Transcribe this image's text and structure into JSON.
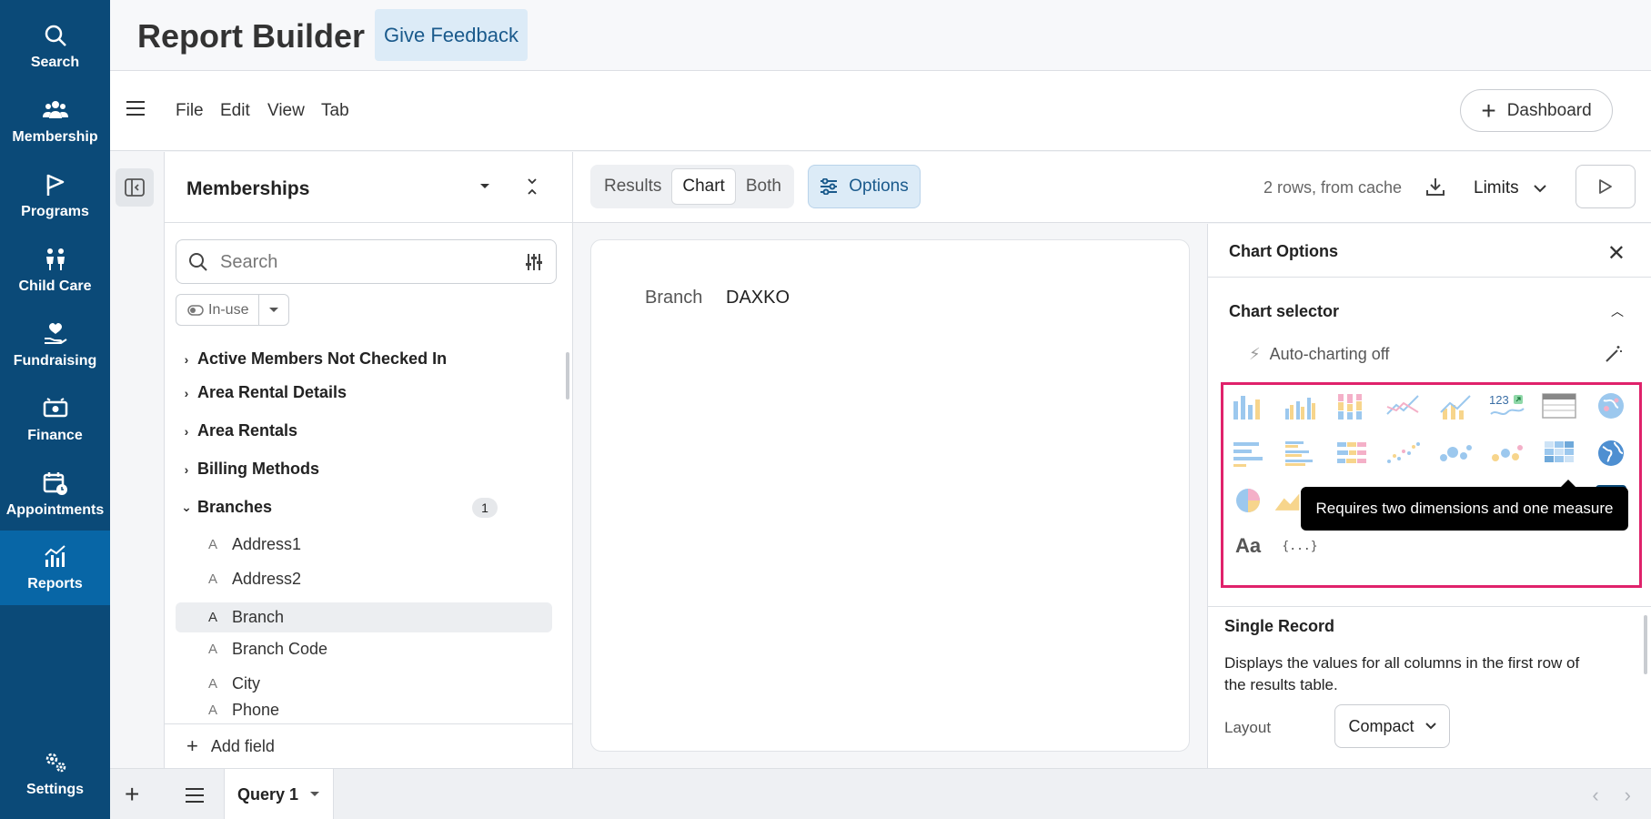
{
  "nav": {
    "items": [
      {
        "label": "Search",
        "icon": "search-icon"
      },
      {
        "label": "Membership",
        "icon": "people-icon"
      },
      {
        "label": "Programs",
        "icon": "flag-icon"
      },
      {
        "label": "Child Care",
        "icon": "child-care-icon"
      },
      {
        "label": "Fundraising",
        "icon": "heart-hand-icon"
      },
      {
        "label": "Finance",
        "icon": "money-icon"
      },
      {
        "label": "Appointments",
        "icon": "calendar-clock-icon"
      },
      {
        "label": "Reports",
        "icon": "reports-chart-icon"
      }
    ],
    "active": "Reports",
    "settings": "Settings"
  },
  "header": {
    "title": "Report Builder",
    "feedback": "Give Feedback"
  },
  "menubar": {
    "items": [
      "File",
      "Edit",
      "View",
      "Tab"
    ],
    "dashboard": "Dashboard"
  },
  "fields": {
    "title": "Memberships",
    "search_placeholder": "Search",
    "filter_label": "In-use",
    "groups": [
      {
        "label": "Active Members Not Checked In"
      },
      {
        "label": "Area Rental Details"
      },
      {
        "label": "Area Rentals"
      },
      {
        "label": "Billing Methods"
      },
      {
        "label": "Branches",
        "count": "1"
      }
    ],
    "leaves": [
      "Address1",
      "Address2",
      "Branch",
      "Branch Code",
      "City",
      "Phone"
    ],
    "selected_leaf": "Branch",
    "add_field": "Add field"
  },
  "toolbar": {
    "tabs": [
      "Results",
      "Chart",
      "Both"
    ],
    "active_tab": "Chart",
    "options": "Options",
    "rows_info": "2 rows, from cache",
    "limits": "Limits"
  },
  "record": {
    "label": "Branch",
    "value": "DAXKO"
  },
  "chart_options": {
    "title": "Chart Options",
    "selector_title": "Chart selector",
    "auto": "Auto-charting off",
    "tooltip": "Requires two dimensions and one measure",
    "single_value_text": "123",
    "text_icon": "Aa",
    "json_icon": "{...}",
    "single_record": {
      "title": "Single Record",
      "description": "Displays the values for all columns in the first row of the results table.",
      "layout_label": "Layout",
      "layout_value": "Compact"
    }
  },
  "bottom": {
    "query_tab": "Query 1"
  }
}
